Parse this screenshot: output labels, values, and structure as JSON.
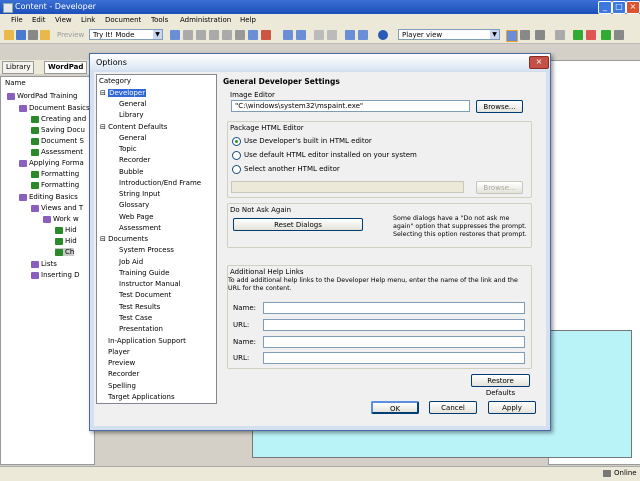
{
  "window": {
    "title": "Content - Developer"
  },
  "menu": [
    "File",
    "Edit",
    "View",
    "Link",
    "Document",
    "Tools",
    "Administration",
    "Help"
  ],
  "toolbar": {
    "preview": "Preview",
    "mode": "Try It! Mode",
    "view": "Player view"
  },
  "left_tabs": [
    "Library",
    "WordPad"
  ],
  "tree": {
    "header": "Name",
    "items": [
      "WordPad Training",
      "Document Basics",
      "Creating and",
      "Saving Docu",
      "Document S",
      "Assessment",
      "Applying Forma",
      "Formatting",
      "Formatting",
      "Editing Basics",
      "Views and T",
      "Work w",
      "Hid",
      "Hid",
      "Ch",
      "Lists",
      "Inserting D"
    ]
  },
  "dialog": {
    "title": "Options",
    "category_header": "Category",
    "categories": [
      "Developer",
      "General",
      "Library",
      "Content Defaults",
      "General",
      "Topic",
      "Recorder",
      "Bubble",
      "Introduction/End Frame",
      "String Input",
      "Glossary",
      "Web Page",
      "Assessment",
      "Documents",
      "System Process",
      "Job Aid",
      "Training Guide",
      "Instructor Manual",
      "Test Document",
      "Test Results",
      "Test Case",
      "Presentation",
      "In-Application Support",
      "Player",
      "Preview",
      "Recorder",
      "Spelling",
      "Target Applications"
    ],
    "heading": "General Developer Settings",
    "image_editor": {
      "label": "Image Editor",
      "value": "\"C:\\windows\\system32\\mspaint.exe\"",
      "browse": "Browse..."
    },
    "package_html": {
      "label": "Package HTML Editor",
      "options": [
        "Use Developer's built in HTML editor",
        "Use default HTML editor installed on your system",
        "Select another HTML editor"
      ],
      "selected_index": 0,
      "browse": "Browse..."
    },
    "do_not_ask": {
      "label": "Do Not Ask Again",
      "button": "Reset Dialogs",
      "description": "Some dialogs have a \"Do not ask me again\" option that suppresses the prompt. Selecting this option restores that prompt."
    },
    "help_links": {
      "label": "Additional Help Links",
      "description": "To add additional help links to the Developer Help menu, enter the name of the link and the URL for the content.",
      "name_label": "Name:",
      "url_label": "URL:"
    },
    "restore_defaults": "Restore Defaults",
    "ok": "OK",
    "cancel": "Cancel",
    "apply": "Apply"
  },
  "status": {
    "online": "Online"
  }
}
